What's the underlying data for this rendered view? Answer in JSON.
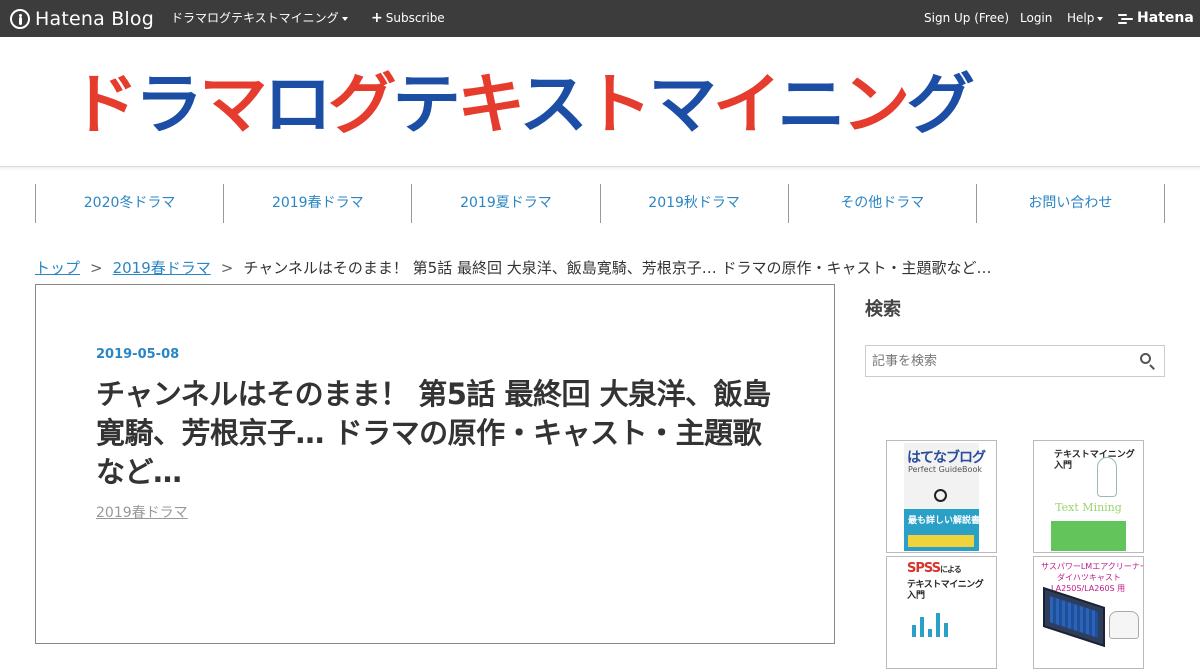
{
  "topbar": {
    "brand": "Hatena Blog",
    "blog_menu": "ドラマログテキストマイニング",
    "subscribe": "Subscribe",
    "signup": "Sign Up (Free)",
    "login": "Login",
    "help": "Help",
    "hatena": "Hatena"
  },
  "header": {
    "banner_text": [
      "ド",
      "ラ",
      "マ",
      "ロ",
      "グ",
      "テ",
      "キ",
      "ス",
      "ト",
      "マ",
      "イ",
      "ニ",
      "ン",
      "グ"
    ],
    "banner_colors": [
      "#e63c2e",
      "#1c4ea6"
    ]
  },
  "nav": {
    "items": [
      "2020冬ドラマ",
      "2019春ドラマ",
      "2019夏ドラマ",
      "2019秋ドラマ",
      "その他ドラマ",
      "お問い合わせ"
    ]
  },
  "breadcrumb": {
    "top": "トップ",
    "category": "2019春ドラマ",
    "separator": ">",
    "current": "チャンネルはそのまま！ 第5話 最終回 大泉洋、飯島寛騎、芳根京子… ドラマの原作・キャスト・主題歌など…"
  },
  "article": {
    "date": "2019-05-08",
    "title": "チャンネルはそのまま！ 第5話 最終回 大泉洋、飯島寛騎、芳根京子… ドラマの原作・キャスト・主題歌など…",
    "category": "2019春ドラマ"
  },
  "sidebar": {
    "search_title": "検索",
    "search_placeholder": "記事を検索",
    "books": {
      "b1_title": "はてなブログ",
      "b1_sub": "Perfect GuideBook",
      "b1_band": "最も詳しい解説書!",
      "b2_title1": "テキストマイニング",
      "b2_title2": "入門",
      "b2_sub": "Text Mining",
      "b3_title": "SPSS",
      "b3_title_small": "による",
      "b3_line2": "テキストマイニング",
      "b3_line3": "入門",
      "b4_line1": "サスパワーLMエアクリーナー",
      "b4_line2": "ダイハツキャスト",
      "b4_line3": "LA250S/LA260S 用"
    }
  },
  "colors": {
    "accent": "#2a86c4",
    "topbar_bg": "#3c3c3c"
  }
}
